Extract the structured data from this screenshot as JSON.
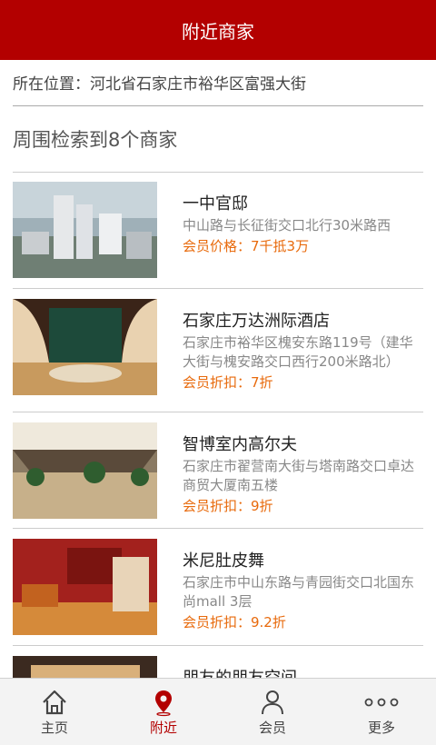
{
  "header": {
    "title": "附近商家"
  },
  "location": {
    "text": "所在位置：河北省石家庄市裕华区富强大街"
  },
  "results": {
    "count_text": "周围检索到8个商家"
  },
  "merchants": [
    {
      "name": "一中官邸",
      "address": "中山路与长征街交口北行30米路西",
      "price": "会员价格：7千抵3万"
    },
    {
      "name": "石家庄万达洲际酒店",
      "address": "石家庄市裕华区槐安东路119号（建华大街与槐安路交口西行200米路北）",
      "price": "会员折扣：7折"
    },
    {
      "name": "智博室内高尔夫",
      "address": "石家庄市翟营南大街与塔南路交口卓达商贸大厦南五楼",
      "price": "会员折扣：9折"
    },
    {
      "name": "米尼肚皮舞",
      "address": "石家庄市中山东路与青园街交口北国东尚mall 3层",
      "price": "会员折扣：9.2折"
    },
    {
      "name": "朋友的朋友空间",
      "address": "",
      "price": ""
    }
  ],
  "tabbar": {
    "items": [
      {
        "label": "主页",
        "icon": "home-icon"
      },
      {
        "label": "附近",
        "icon": "location-pin-icon"
      },
      {
        "label": "会员",
        "icon": "user-icon"
      },
      {
        "label": "更多",
        "icon": "more-dots-icon"
      }
    ],
    "active": "附近"
  },
  "colors": {
    "brand": "#b30000",
    "price": "#e86a0c"
  }
}
